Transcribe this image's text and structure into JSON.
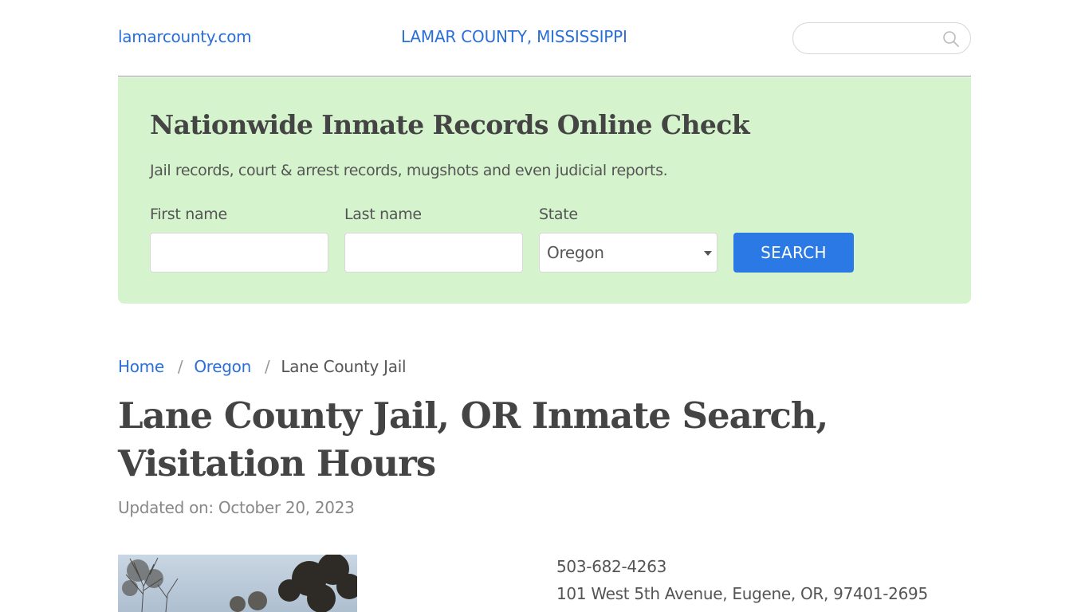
{
  "header": {
    "site_link": "lamarcounty.com",
    "county_title": "LAMAR COUNTY, MISSISSIPPI",
    "search_placeholder": ""
  },
  "banner": {
    "title": "Nationwide Inmate Records Online Check",
    "subtitle": "Jail records, court & arrest records, mugshots and even judicial reports.",
    "first_name_label": "First name",
    "last_name_label": "Last name",
    "state_label": "State",
    "state_value": "Oregon",
    "search_button": "SEARCH",
    "background_color": "#d5f3cc",
    "button_color": "#2a79e4"
  },
  "breadcrumb": {
    "home": "Home",
    "state": "Oregon",
    "current": "Lane County Jail"
  },
  "page": {
    "title": "Lane County Jail, OR Inmate Search, Visitation Hours",
    "updated": "Updated on: October 20, 2023"
  },
  "contact": {
    "phone": "503-682-4263",
    "address": "101 West 5th Avenue, Eugene, OR, 97401-2695"
  },
  "colors": {
    "link": "#2a6fd6",
    "text": "#444444"
  }
}
